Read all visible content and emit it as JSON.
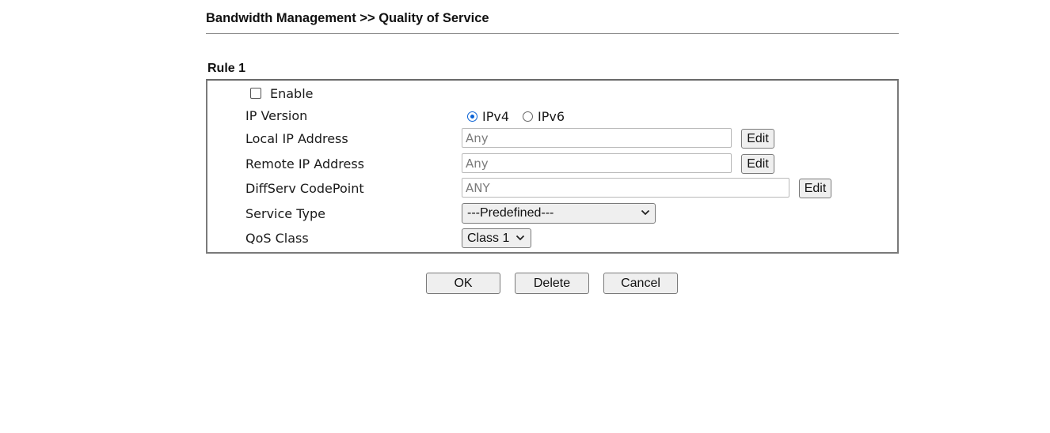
{
  "header": {
    "title": "Bandwidth Management >> Quality of Service"
  },
  "rule": {
    "label": "Rule 1",
    "enable_label": "Enable",
    "enable_checked": false,
    "fields": {
      "ip_version": {
        "label": "IP Version",
        "options": [
          "IPv4",
          "IPv6"
        ],
        "selected": "IPv4"
      },
      "local_ip": {
        "label": "Local IP Address",
        "value": "Any",
        "edit_label": "Edit"
      },
      "remote_ip": {
        "label": "Remote IP Address",
        "value": "Any",
        "edit_label": "Edit"
      },
      "diffserv": {
        "label": "DiffServ CodePoint",
        "value": "ANY",
        "edit_label": "Edit"
      },
      "service_type": {
        "label": "Service Type",
        "selected": "---Predefined---"
      },
      "qos_class": {
        "label": "QoS Class",
        "selected": "Class 1"
      }
    }
  },
  "actions": {
    "ok_label": "OK",
    "delete_label": "Delete",
    "cancel_label": "Cancel"
  },
  "colors": {
    "radio_accent": "#0b63d6",
    "button_bg": "#efefef",
    "border": "#7a7a7a"
  }
}
